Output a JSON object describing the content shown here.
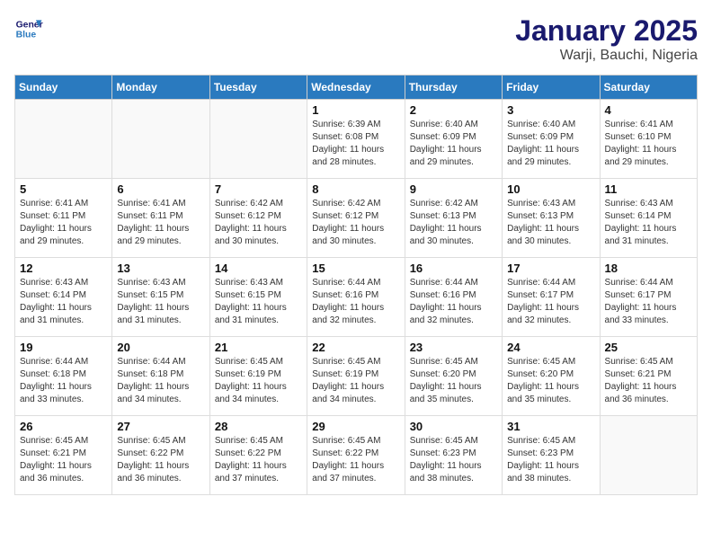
{
  "logo": {
    "line1": "General",
    "line2": "Blue"
  },
  "title": "January 2025",
  "subtitle": "Warji, Bauchi, Nigeria",
  "weekdays": [
    "Sunday",
    "Monday",
    "Tuesday",
    "Wednesday",
    "Thursday",
    "Friday",
    "Saturday"
  ],
  "weeks": [
    [
      {
        "day": "",
        "detail": ""
      },
      {
        "day": "",
        "detail": ""
      },
      {
        "day": "",
        "detail": ""
      },
      {
        "day": "1",
        "detail": "Sunrise: 6:39 AM\nSunset: 6:08 PM\nDaylight: 11 hours\nand 28 minutes."
      },
      {
        "day": "2",
        "detail": "Sunrise: 6:40 AM\nSunset: 6:09 PM\nDaylight: 11 hours\nand 29 minutes."
      },
      {
        "day": "3",
        "detail": "Sunrise: 6:40 AM\nSunset: 6:09 PM\nDaylight: 11 hours\nand 29 minutes."
      },
      {
        "day": "4",
        "detail": "Sunrise: 6:41 AM\nSunset: 6:10 PM\nDaylight: 11 hours\nand 29 minutes."
      }
    ],
    [
      {
        "day": "5",
        "detail": "Sunrise: 6:41 AM\nSunset: 6:11 PM\nDaylight: 11 hours\nand 29 minutes."
      },
      {
        "day": "6",
        "detail": "Sunrise: 6:41 AM\nSunset: 6:11 PM\nDaylight: 11 hours\nand 29 minutes."
      },
      {
        "day": "7",
        "detail": "Sunrise: 6:42 AM\nSunset: 6:12 PM\nDaylight: 11 hours\nand 30 minutes."
      },
      {
        "day": "8",
        "detail": "Sunrise: 6:42 AM\nSunset: 6:12 PM\nDaylight: 11 hours\nand 30 minutes."
      },
      {
        "day": "9",
        "detail": "Sunrise: 6:42 AM\nSunset: 6:13 PM\nDaylight: 11 hours\nand 30 minutes."
      },
      {
        "day": "10",
        "detail": "Sunrise: 6:43 AM\nSunset: 6:13 PM\nDaylight: 11 hours\nand 30 minutes."
      },
      {
        "day": "11",
        "detail": "Sunrise: 6:43 AM\nSunset: 6:14 PM\nDaylight: 11 hours\nand 31 minutes."
      }
    ],
    [
      {
        "day": "12",
        "detail": "Sunrise: 6:43 AM\nSunset: 6:14 PM\nDaylight: 11 hours\nand 31 minutes."
      },
      {
        "day": "13",
        "detail": "Sunrise: 6:43 AM\nSunset: 6:15 PM\nDaylight: 11 hours\nand 31 minutes."
      },
      {
        "day": "14",
        "detail": "Sunrise: 6:43 AM\nSunset: 6:15 PM\nDaylight: 11 hours\nand 31 minutes."
      },
      {
        "day": "15",
        "detail": "Sunrise: 6:44 AM\nSunset: 6:16 PM\nDaylight: 11 hours\nand 32 minutes."
      },
      {
        "day": "16",
        "detail": "Sunrise: 6:44 AM\nSunset: 6:16 PM\nDaylight: 11 hours\nand 32 minutes."
      },
      {
        "day": "17",
        "detail": "Sunrise: 6:44 AM\nSunset: 6:17 PM\nDaylight: 11 hours\nand 32 minutes."
      },
      {
        "day": "18",
        "detail": "Sunrise: 6:44 AM\nSunset: 6:17 PM\nDaylight: 11 hours\nand 33 minutes."
      }
    ],
    [
      {
        "day": "19",
        "detail": "Sunrise: 6:44 AM\nSunset: 6:18 PM\nDaylight: 11 hours\nand 33 minutes."
      },
      {
        "day": "20",
        "detail": "Sunrise: 6:44 AM\nSunset: 6:18 PM\nDaylight: 11 hours\nand 34 minutes."
      },
      {
        "day": "21",
        "detail": "Sunrise: 6:45 AM\nSunset: 6:19 PM\nDaylight: 11 hours\nand 34 minutes."
      },
      {
        "day": "22",
        "detail": "Sunrise: 6:45 AM\nSunset: 6:19 PM\nDaylight: 11 hours\nand 34 minutes."
      },
      {
        "day": "23",
        "detail": "Sunrise: 6:45 AM\nSunset: 6:20 PM\nDaylight: 11 hours\nand 35 minutes."
      },
      {
        "day": "24",
        "detail": "Sunrise: 6:45 AM\nSunset: 6:20 PM\nDaylight: 11 hours\nand 35 minutes."
      },
      {
        "day": "25",
        "detail": "Sunrise: 6:45 AM\nSunset: 6:21 PM\nDaylight: 11 hours\nand 36 minutes."
      }
    ],
    [
      {
        "day": "26",
        "detail": "Sunrise: 6:45 AM\nSunset: 6:21 PM\nDaylight: 11 hours\nand 36 minutes."
      },
      {
        "day": "27",
        "detail": "Sunrise: 6:45 AM\nSunset: 6:22 PM\nDaylight: 11 hours\nand 36 minutes."
      },
      {
        "day": "28",
        "detail": "Sunrise: 6:45 AM\nSunset: 6:22 PM\nDaylight: 11 hours\nand 37 minutes."
      },
      {
        "day": "29",
        "detail": "Sunrise: 6:45 AM\nSunset: 6:22 PM\nDaylight: 11 hours\nand 37 minutes."
      },
      {
        "day": "30",
        "detail": "Sunrise: 6:45 AM\nSunset: 6:23 PM\nDaylight: 11 hours\nand 38 minutes."
      },
      {
        "day": "31",
        "detail": "Sunrise: 6:45 AM\nSunset: 6:23 PM\nDaylight: 11 hours\nand 38 minutes."
      },
      {
        "day": "",
        "detail": ""
      }
    ]
  ]
}
